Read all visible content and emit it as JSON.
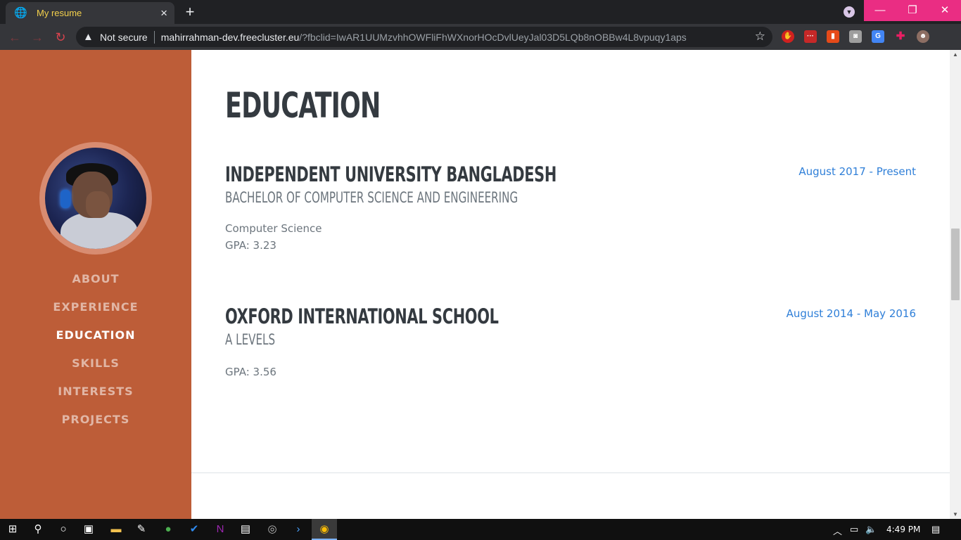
{
  "browser": {
    "tab_title": "My resume",
    "tab_close": "×",
    "new_tab": "+",
    "window": {
      "minimize": "—",
      "maximize": "❐",
      "close": "✕"
    },
    "security_label": "Not secure",
    "url_host": "mahirrahman-dev.freecluster.eu",
    "url_path": "/?fbclid=IwAR1UUMzvhhOWFliFhWXnorHOcDvlUeyJal03D5LQb8nOBBw4L8vpuqy1aps",
    "icons": [
      "globe-icon",
      "back-icon",
      "forward-icon",
      "reload-icon",
      "warning-icon",
      "star-icon",
      "tab-search-icon"
    ],
    "extensions": [
      "red-hand-extension-icon",
      "lastpass-extension-icon",
      "office-extension-icon",
      "mask-extension-icon",
      "google-translate-extension-icon",
      "puzzle-extensions-icon",
      "profile-avatar-icon"
    ]
  },
  "sidebar": {
    "menu": [
      {
        "label": "ABOUT",
        "active": false
      },
      {
        "label": "EXPERIENCE",
        "active": false
      },
      {
        "label": "EDUCATION",
        "active": true
      },
      {
        "label": "SKILLS",
        "active": false
      },
      {
        "label": "INTERESTS",
        "active": false
      },
      {
        "label": "PROJECTS",
        "active": false
      }
    ]
  },
  "main": {
    "heading": "EDUCATION",
    "entries": [
      {
        "school": "INDEPENDENT UNIVERSITY BANGLADESH",
        "degree": "BACHELOR OF COMPUTER SCIENCE AND ENGINEERING",
        "dates": "August 2017 - Present",
        "details": [
          "Computer Science",
          "GPA: 3.23"
        ]
      },
      {
        "school": "OXFORD INTERNATIONAL SCHOOL",
        "degree": "A LEVELS",
        "dates": "August 2014 - May 2016",
        "details": [
          "GPA: 3.56"
        ]
      }
    ]
  },
  "taskbar": {
    "clock": "4:49 PM"
  },
  "colors": {
    "sidebar": "#bd5d38",
    "accent_link": "#2f7fd8",
    "window_buttons": "#ea2d83",
    "heading": "#343a40"
  }
}
